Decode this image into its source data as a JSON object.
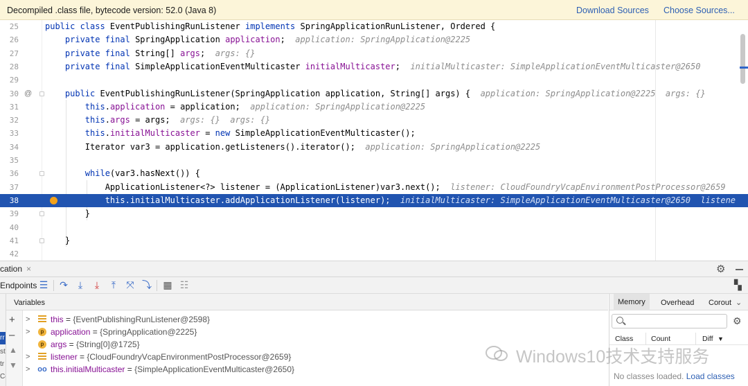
{
  "banner": {
    "message": "Decompiled .class file, bytecode version: 52.0 (Java 8)",
    "download_sources": "Download Sources",
    "choose_sources": "Choose Sources..."
  },
  "editor": {
    "lines": [
      {
        "num": "25",
        "code": "public class EventPublishingRunListener implements SpringApplicationRunListener, Ordered {"
      },
      {
        "num": "26",
        "code": "    private final SpringApplication application;",
        "hint": "application: SpringApplication@2225"
      },
      {
        "num": "27",
        "code": "    private final String[] args;",
        "hint": "args: {}"
      },
      {
        "num": "28",
        "code": "    private final SimpleApplicationEventMulticaster initialMulticaster;",
        "hint": "initialMulticaster: SimpleApplicationEventMulticaster@2650"
      },
      {
        "num": "29",
        "code": ""
      },
      {
        "num": "30",
        "code": "    public EventPublishingRunListener(SpringApplication application, String[] args) {",
        "hint": "application: SpringApplication@2225  args: {}"
      },
      {
        "num": "31",
        "code": "        this.application = application;",
        "hint": "application: SpringApplication@2225"
      },
      {
        "num": "32",
        "code": "        this.args = args;",
        "hint": "args: {}  args: {}"
      },
      {
        "num": "33",
        "code": "        this.initialMulticaster = new SimpleApplicationEventMulticaster();"
      },
      {
        "num": "34",
        "code": "        Iterator var3 = application.getListeners().iterator();",
        "hint": "application: SpringApplication@2225"
      },
      {
        "num": "35",
        "code": ""
      },
      {
        "num": "36",
        "code": "        while(var3.hasNext()) {"
      },
      {
        "num": "37",
        "code": "            ApplicationListener<?> listener = (ApplicationListener)var3.next();",
        "hint": "listener: CloudFoundryVcapEnvironmentPostProcessor@2659"
      },
      {
        "num": "38",
        "code": "            this.initialMulticaster.addApplicationListener(listener);",
        "hint": "initialMulticaster: SimpleApplicationEventMulticaster@2650  listene"
      },
      {
        "num": "39",
        "code": "        }"
      },
      {
        "num": "40",
        "code": ""
      },
      {
        "num": "41",
        "code": "    }"
      },
      {
        "num": "42",
        "code": ""
      }
    ],
    "override_marker": "@"
  },
  "debug": {
    "tab_label": "cation",
    "tab_close": "×",
    "toolbar_label": "Endpoints",
    "variables_title": "Variables",
    "variables": [
      {
        "name": "this",
        "value": "{EventPublishingRunListener@2598}",
        "icon": "list-icon",
        "expandable": true
      },
      {
        "name": "application",
        "value": "{SpringApplication@2225}",
        "icon": "p",
        "expandable": true
      },
      {
        "name": "args",
        "value": "{String[0]@1725}",
        "icon": "p",
        "expandable": false
      },
      {
        "name": "listener",
        "value": "{CloudFoundryVcapEnvironmentPostProcessor@2659}",
        "icon": "list-icon",
        "expandable": true
      },
      {
        "name": "this.initialMulticaster",
        "value": "{SimpleApplicationEventMulticaster@2650}",
        "icon": "oo",
        "expandable": true
      }
    ],
    "left_fragments": [
      "rr",
      "st",
      "tr",
      "Cc"
    ]
  },
  "memory": {
    "tabs": [
      "Memory",
      "Overhead",
      "Corout"
    ],
    "columns": [
      "Class",
      "Count",
      "Diff"
    ],
    "empty_text": "No classes loaded.",
    "load_link": "Load classes"
  },
  "watermark": "Windows10技术支持服务",
  "colors": {
    "banner_bg": "#fcf5d9",
    "selection": "#2154b0",
    "keyword": "#0033b3",
    "field": "#871094",
    "breakpoint": "#f3a21b",
    "link": "#2d5fb3"
  }
}
